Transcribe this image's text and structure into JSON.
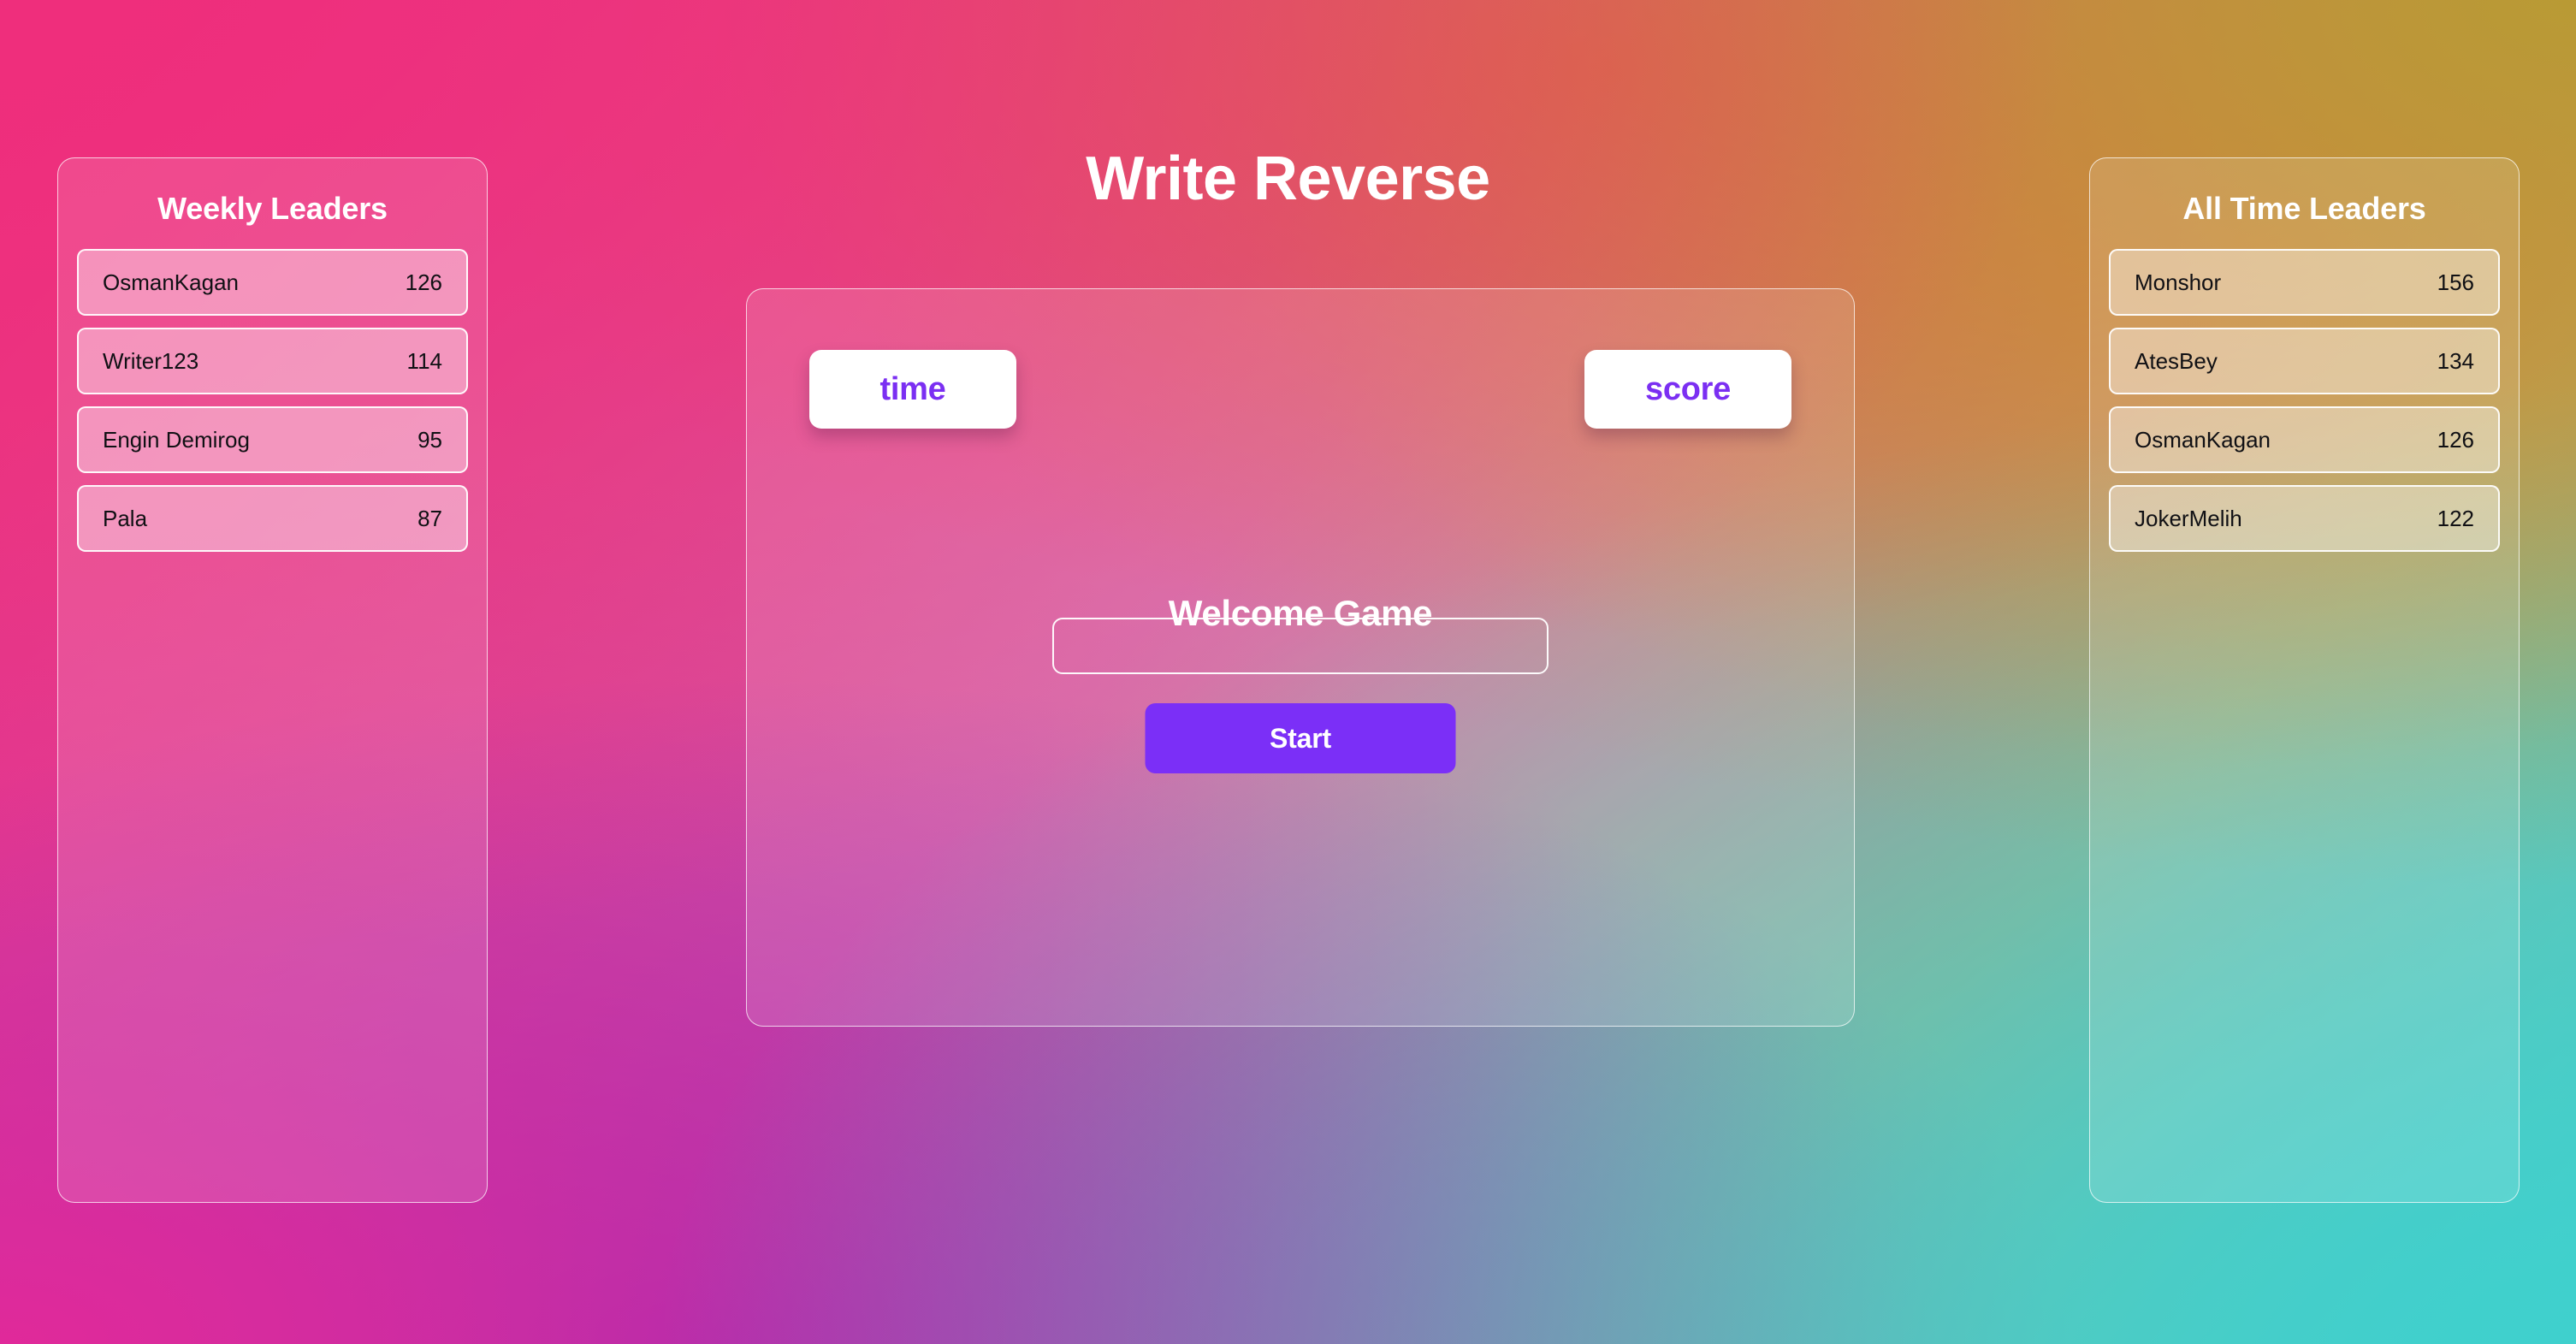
{
  "app": {
    "title": "Write Reverse",
    "accent_purple": "#7b2ff7",
    "panel_border": "#ffffff"
  },
  "weekly_leaderboard": {
    "title": "Weekly Leaders",
    "rows": [
      {
        "name": "OsmanKagan",
        "score": "126"
      },
      {
        "name": "Writer123",
        "score": "114"
      },
      {
        "name": "Engin Demirog",
        "score": "95"
      },
      {
        "name": "Pala",
        "score": "87"
      }
    ]
  },
  "alltime_leaderboard": {
    "title": "All Time Leaders",
    "rows": [
      {
        "name": "Monshor",
        "score": "156"
      },
      {
        "name": "AtesBey",
        "score": "134"
      },
      {
        "name": "OsmanKagan",
        "score": "126"
      },
      {
        "name": "JokerMelih",
        "score": "122"
      }
    ]
  },
  "game": {
    "time_label": "time",
    "score_label": "score",
    "welcome_heading": "Welcome Game",
    "input_value": "",
    "input_placeholder": "",
    "start_label": "Start"
  }
}
